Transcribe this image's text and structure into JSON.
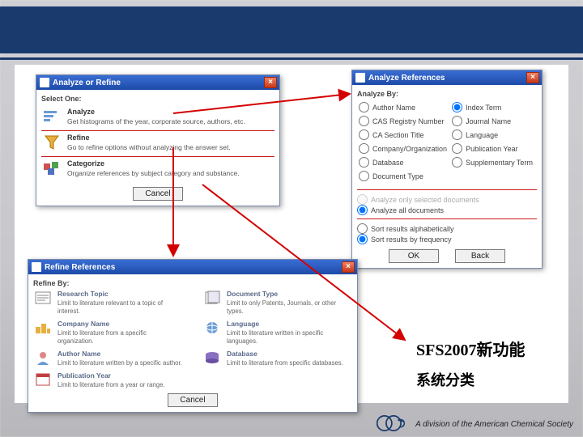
{
  "analyzeRefine": {
    "title": "Analyze or Refine",
    "selectOne": "Select One:",
    "rows": [
      {
        "name": "Analyze",
        "desc": "Get histograms of the year, corporate source, authors, etc."
      },
      {
        "name": "Refine",
        "desc": "Go to refine options without analyzing the answer set."
      },
      {
        "name": "Categorize",
        "desc": "Organize references by subject category and substance."
      }
    ],
    "cancel": "Cancel"
  },
  "analyzeRefs": {
    "title": "Analyze References",
    "analyzeBy": "Analyze By:",
    "left": [
      "Author Name",
      "CAS Registry Number",
      "CA Section Title",
      "Company/Organization",
      "Database",
      "Document Type"
    ],
    "right": [
      "Index Term",
      "Journal Name",
      "Language",
      "Publication Year",
      "Supplementary Term"
    ],
    "selectedRight": 0,
    "scope": [
      {
        "label": "Analyze only selected documents",
        "checked": false,
        "disabled": true
      },
      {
        "label": "Analyze all documents",
        "checked": true,
        "disabled": false
      }
    ],
    "sort": [
      {
        "label": "Sort results alphabetically",
        "checked": false
      },
      {
        "label": "Sort results by frequency",
        "checked": true
      }
    ],
    "ok": "OK",
    "back": "Back"
  },
  "refineRefs": {
    "title": "Refine References",
    "refineBy": "Refine By:",
    "items": [
      {
        "name": "Research Topic",
        "desc": "Limit to literature relevant to a topic of interest."
      },
      {
        "name": "Document Type",
        "desc": "Limit to only Patents, Journals, or other types."
      },
      {
        "name": "Company Name",
        "desc": "Limit to literature from a specific organization."
      },
      {
        "name": "Language",
        "desc": "Limit to literature written in specific languages."
      },
      {
        "name": "Author Name",
        "desc": "Limit to literature written by a specific author."
      },
      {
        "name": "Database",
        "desc": "Limit to literature from specific databases."
      },
      {
        "name": "Publication Year",
        "desc": "Limit to literature from a year or range."
      }
    ],
    "cancel": "Cancel"
  },
  "labels": {
    "big": "SFS2007新功能",
    "small": "系统分类"
  },
  "footer": "A division of the American Chemical Society"
}
